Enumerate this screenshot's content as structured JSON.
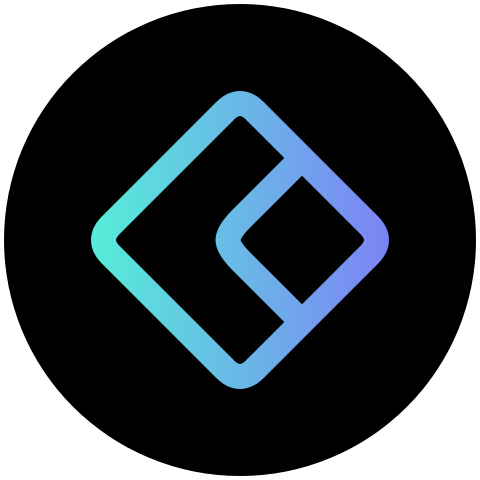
{
  "logo": {
    "icon_name": "diamond-bracket-logo",
    "background_color": "#000000",
    "page_background_color": "#ffffff",
    "gradient_colors": [
      "#56ecd9",
      "#7d82f5"
    ]
  }
}
